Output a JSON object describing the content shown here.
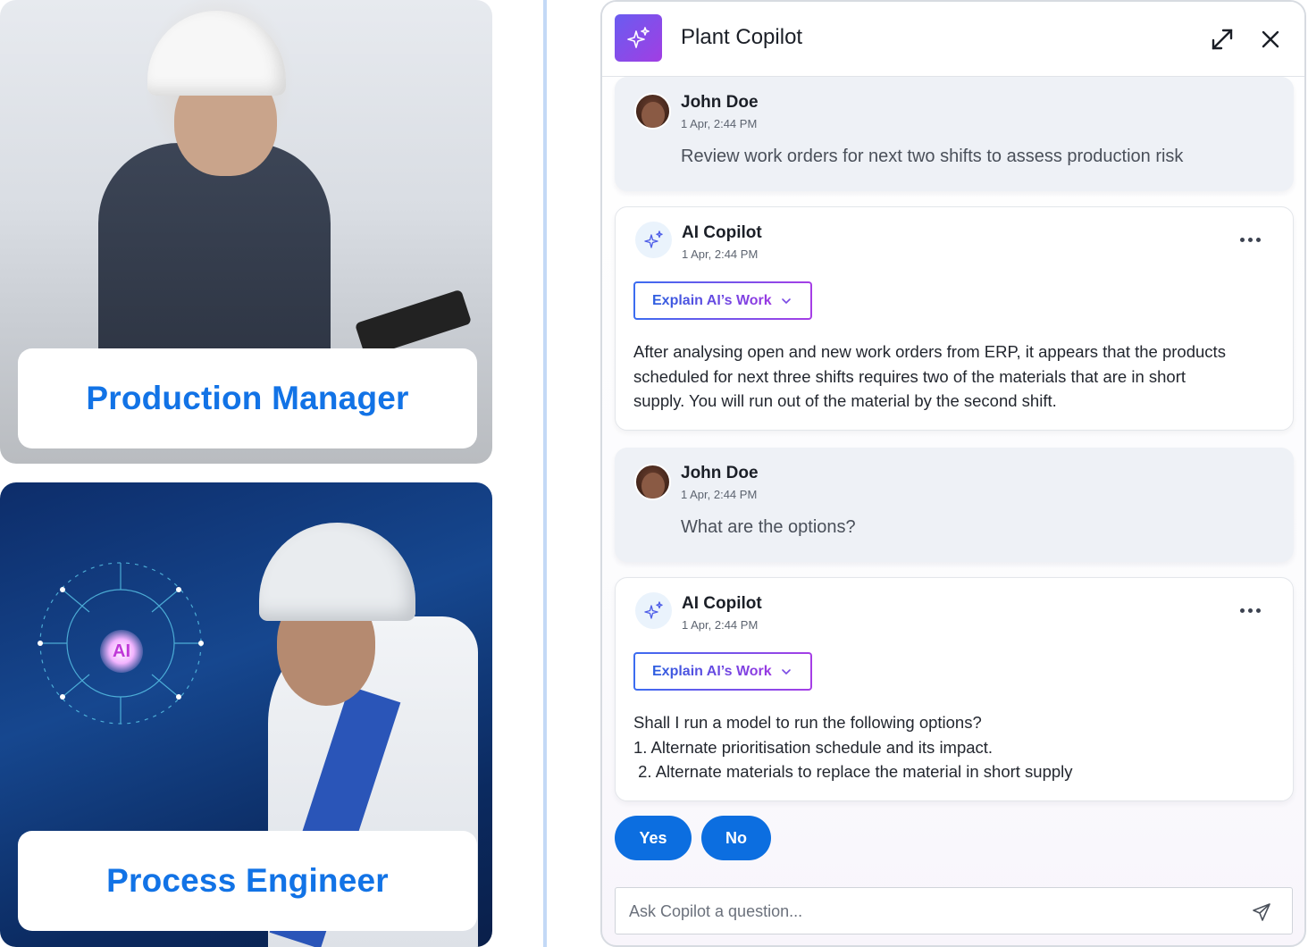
{
  "personas": [
    {
      "label": "Production Manager"
    },
    {
      "label": "Process Engineer"
    }
  ],
  "chat": {
    "app_title": "Plant Copilot",
    "messages": [
      {
        "sender": "John Doe",
        "time": "1 Apr, 2:44 PM",
        "text": "Review work orders for next two shifts to assess production risk"
      },
      {
        "sender": "AI Copilot",
        "time": "1 Apr, 2:44 PM",
        "explain_label": "Explain AI’s Work",
        "lines": [
          "After analysing open and new work orders from ERP, it appears that the products",
          "scheduled for next three shifts requires two of the materials that are in short",
          "supply. You will run out of the material by the second shift."
        ]
      },
      {
        "sender": "John Doe",
        "time": "1 Apr, 2:44 PM",
        "text": "What are the options?"
      },
      {
        "sender": "AI Copilot",
        "time": "1 Apr, 2:44 PM",
        "explain_label": "Explain AI’s Work",
        "lines": [
          "Shall I run a model to run the following options?",
          "1. Alternate prioritisation schedule and its impact.",
          " 2. Alternate materials to replace the material in short supply"
        ]
      }
    ],
    "yes_label": "Yes",
    "no_label": "No",
    "input_placeholder": "Ask Copilot a question..."
  },
  "icons": {
    "app_logo": "sparkles-icon",
    "expand": "expand-icon",
    "close": "close-icon",
    "more": "more-horizontal-icon",
    "chevron": "chevron-down-icon",
    "send": "send-icon"
  },
  "colors": {
    "accent_blue": "#0c6ee0",
    "persona_text": "#1273e6",
    "logo_gradient_start": "#6a5cf0",
    "logo_gradient_end": "#a13ee3"
  }
}
